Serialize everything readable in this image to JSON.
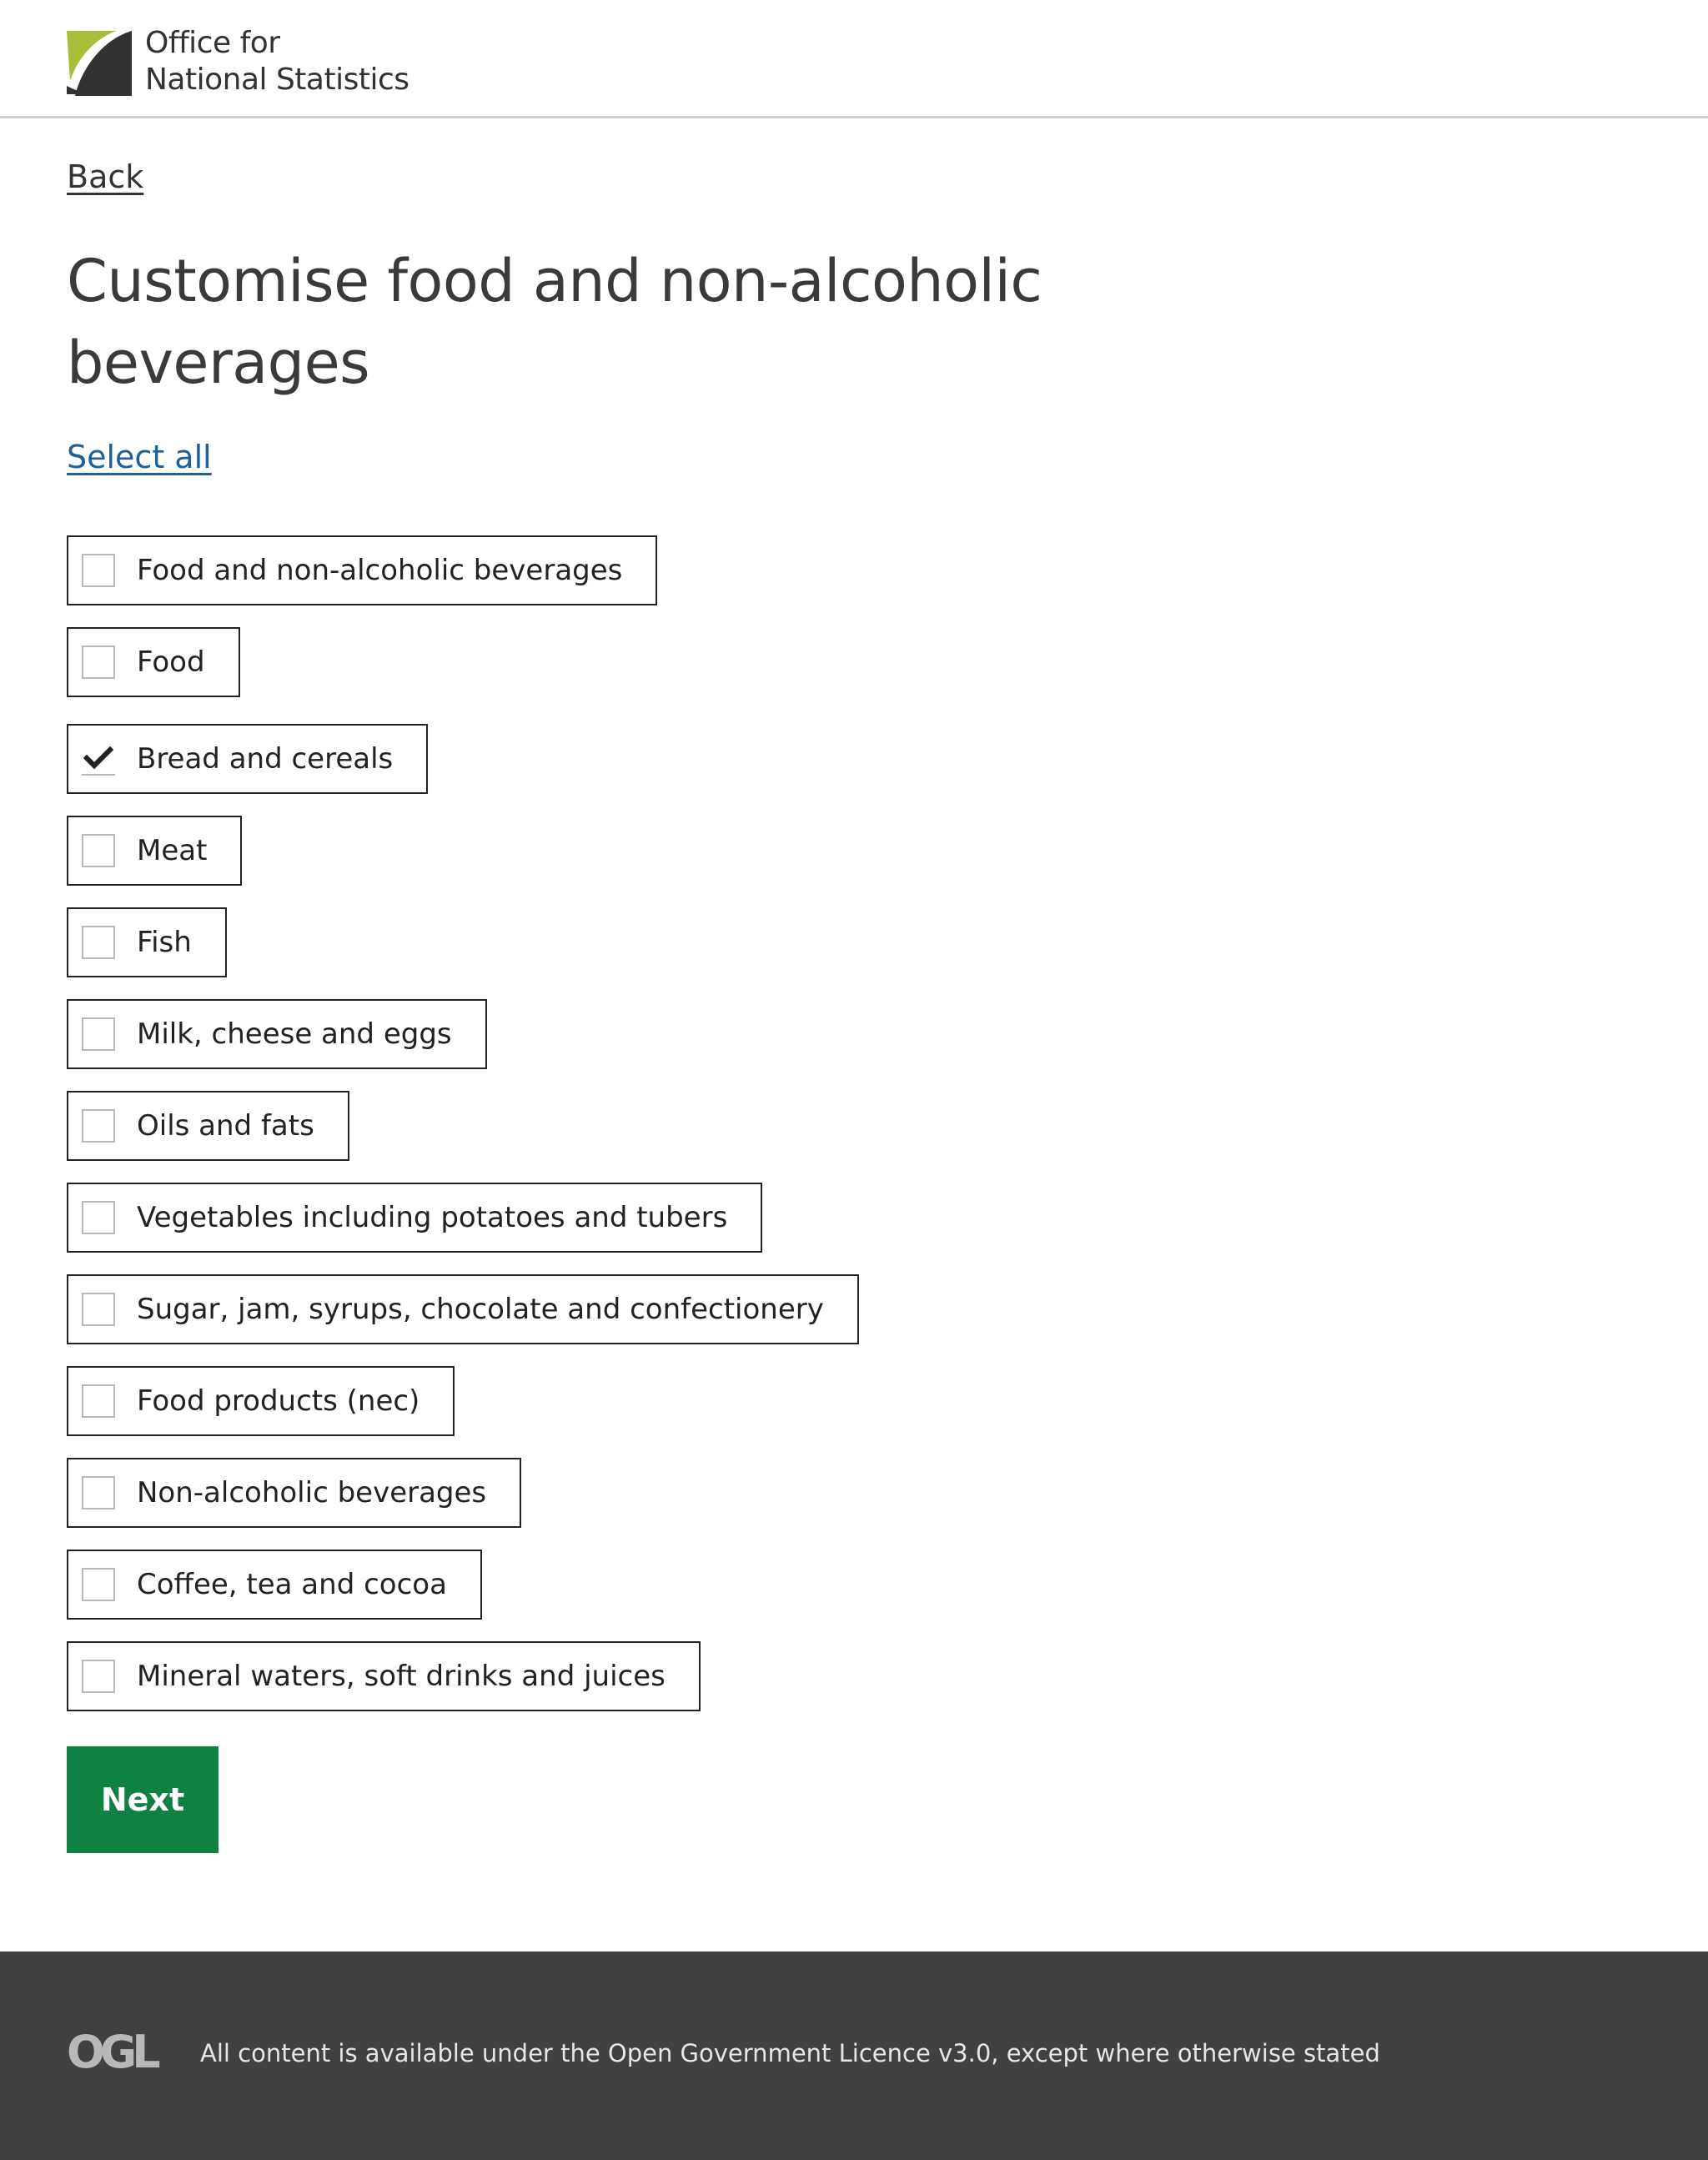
{
  "header": {
    "logo_line1": "Office for",
    "logo_line2": "National Statistics"
  },
  "nav": {
    "back_label": "Back"
  },
  "page": {
    "title": "Customise food and non-alcoholic beverages",
    "select_all_label": "Select all"
  },
  "options": [
    {
      "label": "Food and non-alcoholic beverages",
      "checked": false
    },
    {
      "label": "Food",
      "checked": false
    },
    {
      "label": "Bread and cereals",
      "checked": true
    },
    {
      "label": "Meat",
      "checked": false
    },
    {
      "label": "Fish",
      "checked": false
    },
    {
      "label": "Milk, cheese and eggs",
      "checked": false
    },
    {
      "label": "Oils and fats",
      "checked": false
    },
    {
      "label": "Vegetables including potatoes and tubers",
      "checked": false
    },
    {
      "label": "Sugar, jam, syrups, chocolate and confectionery",
      "checked": false
    },
    {
      "label": "Food products (nec)",
      "checked": false
    },
    {
      "label": "Non-alcoholic beverages",
      "checked": false
    },
    {
      "label": "Coffee, tea and cocoa",
      "checked": false
    },
    {
      "label": "Mineral waters, soft drinks and juices",
      "checked": false
    }
  ],
  "actions": {
    "next_label": "Next"
  },
  "footer": {
    "licence_text": "All content is available under the Open Government Licence v3.0, except where otherwise stated",
    "ogl_logo_text": "OGL"
  },
  "colors": {
    "link": "#206095",
    "button": "#0f8243",
    "footer_bg": "#414042",
    "logo_green": "#a8bd3a",
    "logo_dark": "#323232"
  }
}
